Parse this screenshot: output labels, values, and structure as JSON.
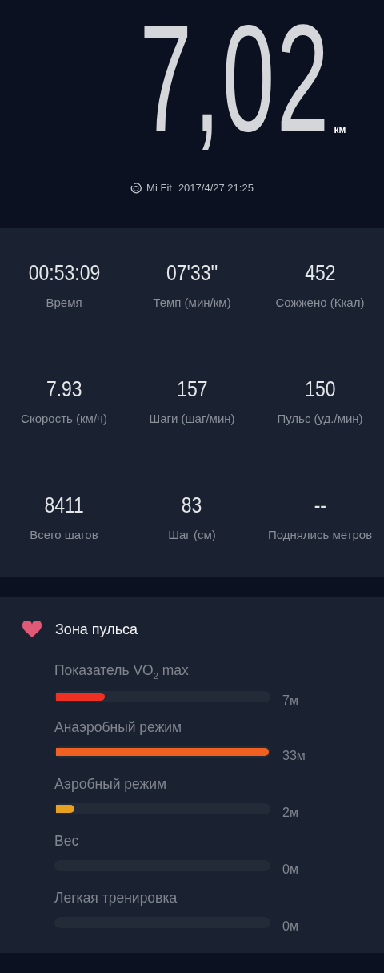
{
  "distance": {
    "value": "7,02",
    "unit": "км"
  },
  "source": {
    "app": "Mi Fit",
    "datetime": "2017/4/27 21:25"
  },
  "stats": [
    {
      "value": "00:53:09",
      "label": "Время"
    },
    {
      "value": "07'33''",
      "label": "Темп (мин/км)"
    },
    {
      "value": "452",
      "label": "Сожжено (Ккал)"
    },
    {
      "value": "7.93",
      "label": "Скорость (км/ч)"
    },
    {
      "value": "157",
      "label": "Шаги (шаг/мин)"
    },
    {
      "value": "150",
      "label": "Пульс (уд./мин)"
    },
    {
      "value": "8411",
      "label": "Всего шагов"
    },
    {
      "value": "83",
      "label": "Шаг (см)"
    },
    {
      "value": "--",
      "label": "Поднялись метров"
    }
  ],
  "heart_zone": {
    "title": "Зона пульса",
    "zones": [
      {
        "label": "Показатель VO$_{2}$ max",
        "level": 0.23,
        "color": "#f03022",
        "duration": "7м"
      },
      {
        "label": "Анаэробный режим",
        "level": 1.0,
        "color": "#f06020",
        "duration": "33м"
      },
      {
        "label": "Аэробный режим",
        "level": 0.085,
        "color": "#e8a020",
        "duration": "2м"
      },
      {
        "label": "Вес",
        "duration": "0м"
      },
      {
        "label": "Легкая тренировка",
        "duration": "0м"
      }
    ]
  }
}
